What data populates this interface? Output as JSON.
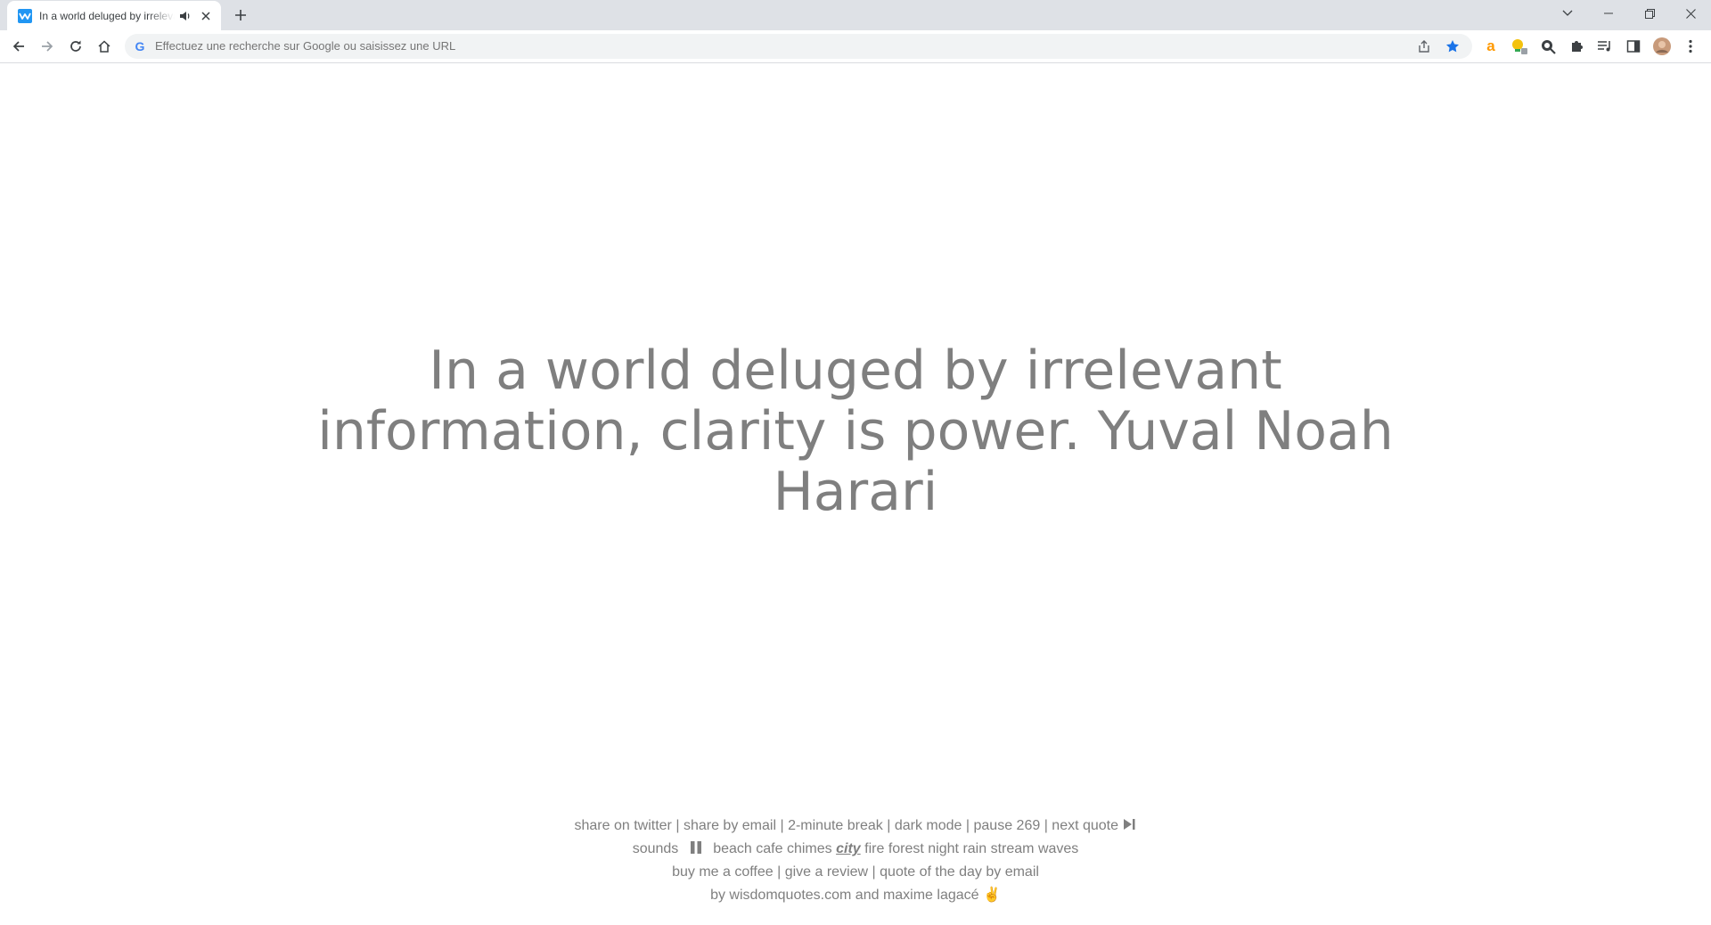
{
  "browser": {
    "tab": {
      "title": "In a world deluged by irrelevant information, clarity is power. Yuval Noah Harari"
    },
    "omnibox": {
      "placeholder": "Effectuez une recherche sur Google ou saisissez une URL"
    },
    "colors": {
      "tabstrip": "#dee1e6",
      "star": "#1a73e8",
      "amazon": "#ff9900"
    },
    "icons": [
      "back-icon",
      "forward-icon",
      "reload-icon",
      "home-icon",
      "share-icon",
      "bookmark-star-icon",
      "amazon-extension-icon",
      "lightbulb-extension-icon",
      "search-extension-icon",
      "extensions-puzzle-icon",
      "media-control-icon",
      "side-panel-icon",
      "profile-avatar",
      "menu-kebab-icon"
    ]
  },
  "page": {
    "quote": "In a world deluged by irrelevant information, clarity is power. Yuval Noah Harari",
    "text_color": "#7f7f7f",
    "footer": {
      "line1": {
        "share_twitter": "share on twitter",
        "share_email": "share by email",
        "break": "2-minute break",
        "dark_mode": "dark mode",
        "pause": "pause 269",
        "next_quote": "next quote",
        "separator": "|"
      },
      "line2": {
        "sounds_label": "sounds",
        "sounds": [
          "beach",
          "cafe",
          "chimes",
          "city",
          "fire",
          "forest",
          "night",
          "rain",
          "stream",
          "waves"
        ],
        "active_sound": "city"
      },
      "line3": {
        "coffee": "buy me a coffee",
        "review": "give a review",
        "qotd": "quote of the day by email"
      },
      "line4": {
        "credit": "by wisdomquotes.com and maxime lagacé",
        "emoji": "✌"
      }
    }
  }
}
